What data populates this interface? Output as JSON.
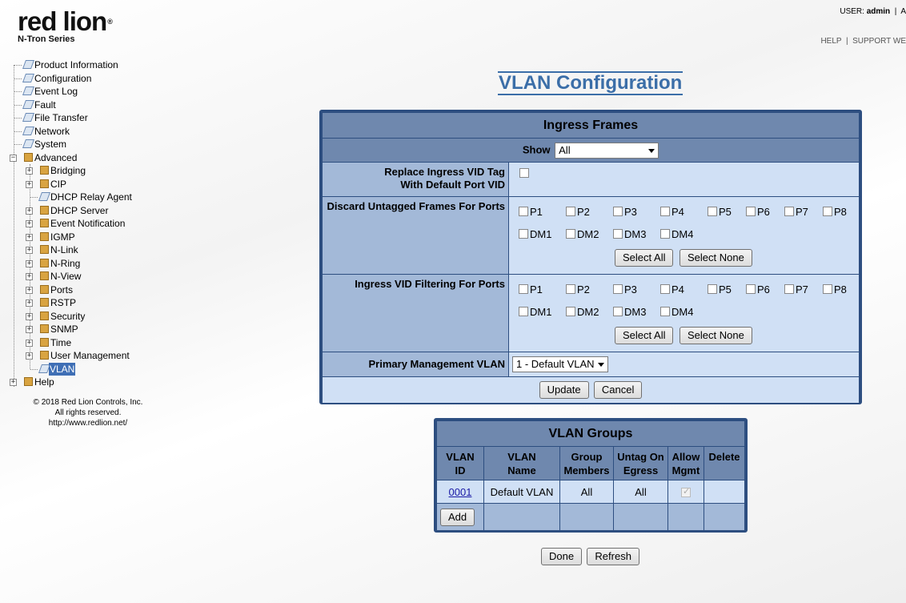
{
  "brand": {
    "logo_text": "red lion",
    "reg_mark": "®",
    "subtitle": "N-Tron Series"
  },
  "header": {
    "user_label": "USER:",
    "user_name": "admin",
    "user_sep": "|",
    "user_trail": "A",
    "help_link": "HELP",
    "link_sep": "|",
    "support_link": "SUPPORT WE"
  },
  "tree": {
    "product_information": "Product Information",
    "configuration": "Configuration",
    "event_log": "Event Log",
    "fault": "Fault",
    "file_transfer": "File Transfer",
    "network": "Network",
    "system": "System",
    "advanced": "Advanced",
    "bridging": "Bridging",
    "cip": "CIP",
    "dhcp_relay_agent": "DHCP Relay Agent",
    "dhcp_server": "DHCP Server",
    "event_notification": "Event Notification",
    "igmp": "IGMP",
    "n_link": "N-Link",
    "n_ring": "N-Ring",
    "n_view": "N-View",
    "ports": "Ports",
    "rstp": "RSTP",
    "security": "Security",
    "snmp": "SNMP",
    "time": "Time",
    "user_management": "User Management",
    "vlan": "VLAN",
    "help": "Help",
    "expand_symbol": "+",
    "collapse_symbol": "−"
  },
  "copyright": {
    "line1": "© 2018 Red Lion Controls, Inc.",
    "line2": "All rights reserved.",
    "line3": "http://www.redlion.net/"
  },
  "page_title": "VLAN Configuration",
  "ingress": {
    "title": "Ingress Frames",
    "show_label": "Show",
    "show_value": "All",
    "replace_label_1": "Replace Ingress VID Tag",
    "replace_label_2": "With Default Port VID",
    "discard_label": "Discard Untagged Frames For Ports",
    "filter_label": "Ingress VID Filtering For Ports",
    "ports": [
      "P1",
      "P2",
      "P3",
      "P4",
      "P5",
      "P6",
      "P7",
      "P8",
      "DM1",
      "DM2",
      "DM3",
      "DM4"
    ],
    "select_all": "Select All",
    "select_none": "Select None",
    "primary_mgmt_label": "Primary Management VLAN",
    "primary_mgmt_value": "1 - Default VLAN",
    "update_button": "Update",
    "cancel_button": "Cancel"
  },
  "groups": {
    "title": "VLAN Groups",
    "columns": {
      "vlan_id_1": "VLAN",
      "vlan_id_2": "ID",
      "vlan_name_1": "VLAN",
      "vlan_name_2": "Name",
      "group_1": "Group",
      "group_2": "Members",
      "untag_1": "Untag On",
      "untag_2": "Egress",
      "allow_1": "Allow",
      "allow_2": "Mgmt",
      "delete": "Delete"
    },
    "rows": [
      {
        "vlan_id": "0001",
        "vlan_name": "Default VLAN",
        "group_members": "All",
        "untag_on_egress": "All",
        "allow_mgmt": true
      }
    ],
    "add_button": "Add"
  },
  "footer": {
    "done_button": "Done",
    "refresh_button": "Refresh"
  }
}
